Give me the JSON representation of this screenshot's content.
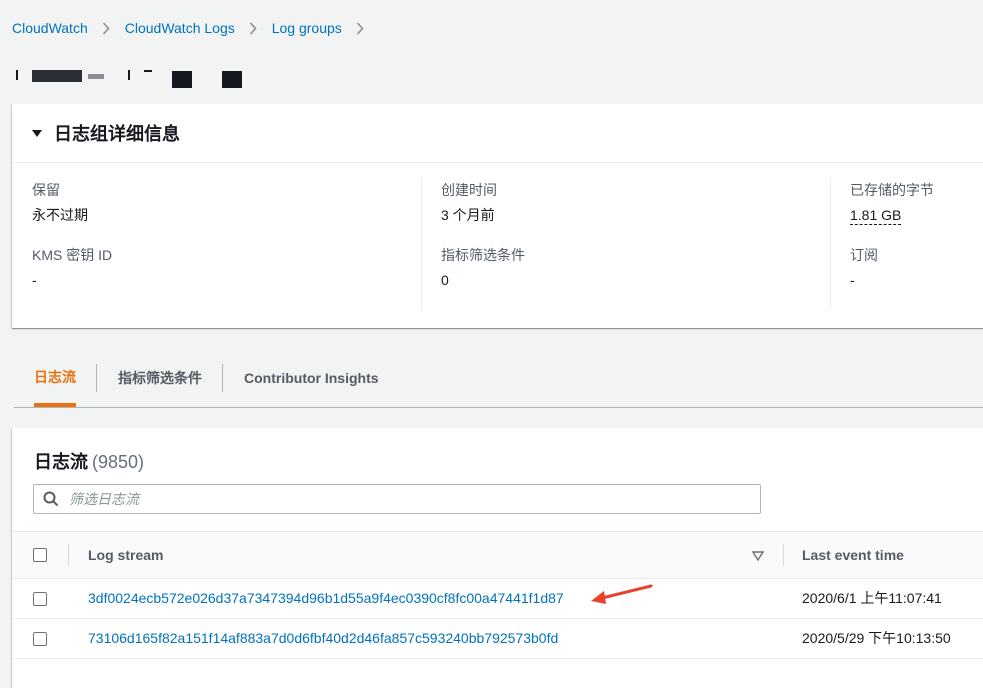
{
  "breadcrumb": {
    "items": [
      "CloudWatch",
      "CloudWatch Logs",
      "Log groups"
    ]
  },
  "details": {
    "title": "日志组详细信息",
    "fields": [
      {
        "label": "保留",
        "value": "永不过期"
      },
      {
        "label": "创建时间",
        "value": "3 个月前"
      },
      {
        "label": "已存储的字节",
        "value": "1.81 GB"
      },
      {
        "label": "KMS 密钥 ID",
        "value": "-"
      },
      {
        "label": "指标筛选条件",
        "value": "0"
      },
      {
        "label": "订阅",
        "value": "-"
      }
    ]
  },
  "tabs": [
    {
      "label": "日志流",
      "active": true
    },
    {
      "label": "指标筛选条件",
      "active": false
    },
    {
      "label": "Contributor Insights",
      "active": false
    }
  ],
  "log_streams": {
    "title": "日志流",
    "count": "(9850)",
    "filter_placeholder": "筛选日志流",
    "columns": {
      "stream": "Log stream",
      "time": "Last event time"
    },
    "rows": [
      {
        "stream": "3df0024ecb572e026d37a7347394d96b1d55a9f4ec0390cf8fc00a47441f1d87",
        "time": "2020/6/1 上午11:07:41"
      },
      {
        "stream": "73106d165f82a151f14af883a7d0d6fbf40d2d46fa857c593240bb792573b0fd",
        "time": "2020/5/29 下午10:13:50"
      }
    ]
  },
  "colors": {
    "link": "#0073bb",
    "active_tab": "#ec7211",
    "annotation_arrow": "#e8412c",
    "background": "#f2f3f3"
  }
}
